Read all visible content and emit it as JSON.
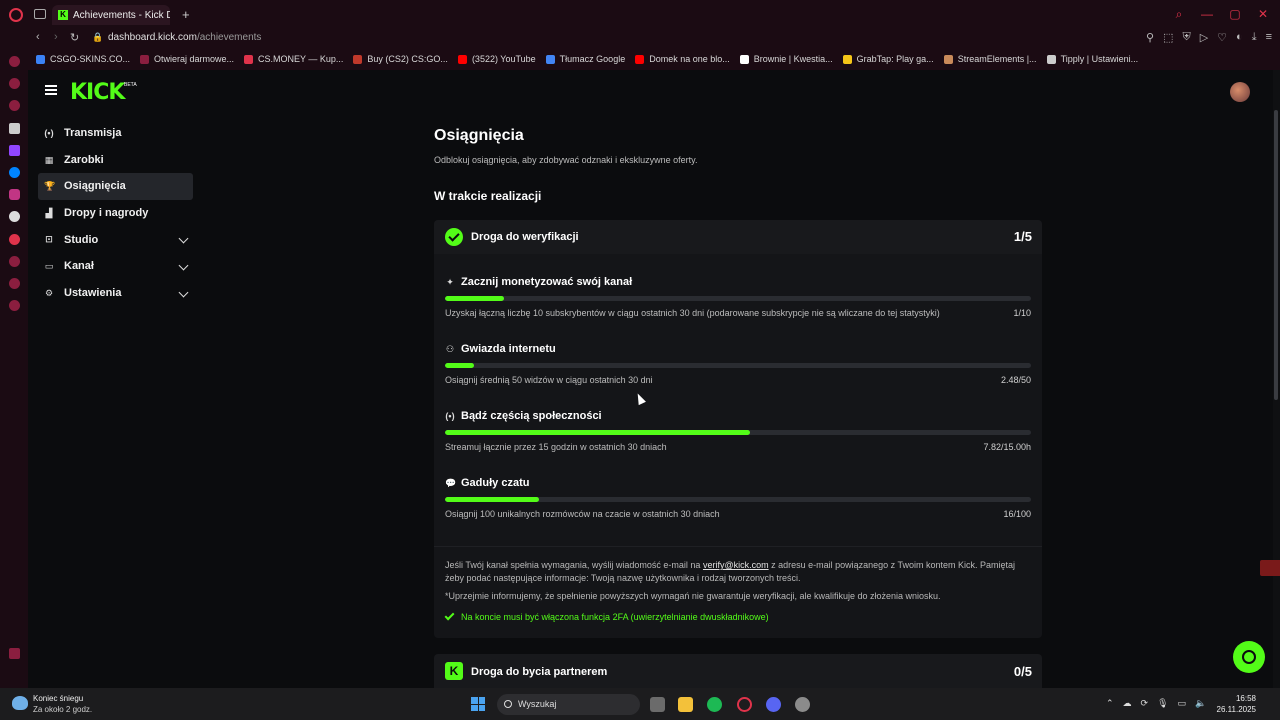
{
  "browser": {
    "tab_title": "Achievements - Kick Dash",
    "url_domain": "dashboard.kick.com",
    "url_path": "/achievements",
    "bookmarks": [
      {
        "label": "CSGO-SKINS.CO...",
        "color": "#3b82f6"
      },
      {
        "label": "Otwieraj darmowe...",
        "color": "#8b1e3f"
      },
      {
        "label": "CS.MONEY — Kup...",
        "color": "#e0334b"
      },
      {
        "label": "Buy (CS2) CS:GO...",
        "color": "#c0392b"
      },
      {
        "label": "(3522) YouTube",
        "color": "#ff0000"
      },
      {
        "label": "Tłumacz Google",
        "color": "#4285f4"
      },
      {
        "label": "Domek na one blo...",
        "color": "#ff0000"
      },
      {
        "label": "Brownie | Kwestia...",
        "color": "#ffffff"
      },
      {
        "label": "GrabTap: Play ga...",
        "color": "#f5c518"
      },
      {
        "label": "StreamElements |...",
        "color": "#c98a5a"
      },
      {
        "label": "Tipply | Ustawieni...",
        "color": "#cccccc"
      }
    ]
  },
  "header": {
    "logo": "KICK",
    "logo_badge": "BETA"
  },
  "sidebar": {
    "items": [
      {
        "label": "Transmisja",
        "icon": "(•)",
        "expandable": false,
        "active": false
      },
      {
        "label": "Zarobki",
        "icon": "▦",
        "expandable": false,
        "active": false
      },
      {
        "label": "Osiągnięcia",
        "icon": "🏆",
        "expandable": false,
        "active": true
      },
      {
        "label": "Dropy i nagrody",
        "icon": "▟",
        "expandable": false,
        "active": false
      },
      {
        "label": "Studio",
        "icon": "⊡",
        "expandable": true,
        "active": false
      },
      {
        "label": "Kanał",
        "icon": "▭",
        "expandable": true,
        "active": false
      },
      {
        "label": "Ustawienia",
        "icon": "⚙",
        "expandable": true,
        "active": false
      }
    ]
  },
  "main": {
    "title": "Osiągnięcia",
    "subtitle": "Odblokuj osiągnięcia, aby zdobywać odznaki i ekskluzywne oferty.",
    "section_title": "W trakcie realizacji",
    "verification": {
      "title": "Droga do weryfikacji",
      "count": "1/5",
      "tasks": [
        {
          "title": "Zacznij monetyzować swój kanał",
          "icon": "✦",
          "desc": "Uzyskaj łączną liczbę 10 subskrybentów w ciągu ostatnich 30 dni (podarowane subskrypcje nie są wliczane do tej statystyki)",
          "value": "1/10",
          "progress": 0.1
        },
        {
          "title": "Gwiazda internetu",
          "icon": "⚇",
          "desc": "Osiągnij średnią 50 widzów w ciągu ostatnich 30 dni",
          "value": "2.48/50",
          "progress": 0.05
        },
        {
          "title": "Bądź częścią społeczności",
          "icon": "(•)",
          "desc": "Streamuj łącznie przez 15 godzin w ostatnich 30 dniach",
          "value": "7.82/15.00h",
          "progress": 0.52
        },
        {
          "title": "Gaduły czatu",
          "icon": "💬",
          "desc": "Osiągnij 100 unikalnych rozmówców na czacie w ostatnich 30 dniach",
          "value": "16/100",
          "progress": 0.16
        }
      ],
      "info_pre": "Jeśli Twój kanał spełnia wymagania, wyślij wiadomość e-mail na ",
      "info_email": "verify@kick.com",
      "info_post": " z adresu e-mail powiązanego z Twoim kontem Kick. Pamiętaj żeby podać następujące informacje: Twoją nazwę użytkownika i rodzaj tworzonych treści.",
      "disclaimer": "*Uprzejmie informujemy, że spełnienie powyższych wymagań nie gwarantuje weryfikacji, ale kwalifikuje do złożenia wniosku.",
      "requirement": "Na koncie musi być włączona funkcja 2FA (uwierzytelnianie dwuskładnikowe)"
    },
    "partner": {
      "title": "Droga do bycia partnerem",
      "count": "0/5",
      "icon_letter": "K"
    }
  },
  "taskbar": {
    "weather_title": "Koniec śniegu",
    "weather_sub": "Za około 2 godz.",
    "search_placeholder": "Wyszukaj",
    "time": "16:58",
    "date": "26.11.2025"
  }
}
